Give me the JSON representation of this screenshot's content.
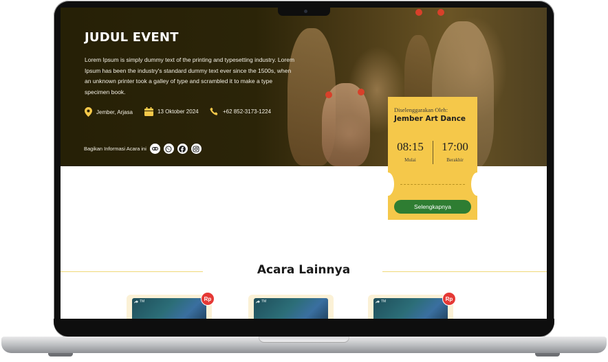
{
  "event": {
    "title": "JUDUL EVENT",
    "description": "Lorem Ipsum is simply dummy text of the printing and typesetting industry. Lorem Ipsum has been the industry's standard dummy text ever since the 1500s, when an unknown printer took a galley of type and scrambled it to make a type specimen book.",
    "location": "Jember, Arjasa",
    "date": "13 Oktober 2024",
    "phone": "+62 852-3173-1224",
    "share_label": "Bagikan Informasi Acara ini",
    "share_icons": [
      "link-icon",
      "whatsapp-icon",
      "facebook-icon",
      "instagram-icon"
    ]
  },
  "ticket": {
    "organizer_label": "Diselenggarakan Oleh:",
    "organizer": "Jember Art Dance",
    "start_time": "08:15",
    "start_label": "Mulai",
    "end_time": "17:00",
    "end_label": "Berakhir",
    "button_label": "Selengkapnya"
  },
  "other_events": {
    "heading": "Acara Lainnya",
    "cards": [
      {
        "badge": "TM",
        "price_badge": "Rp"
      },
      {
        "badge": "TM",
        "price_badge": ""
      },
      {
        "badge": "TM",
        "price_badge": "Rp"
      }
    ]
  },
  "colors": {
    "accent_yellow": "#f5c84a",
    "button_green": "#2e7d32",
    "price_red": "#e53935"
  }
}
